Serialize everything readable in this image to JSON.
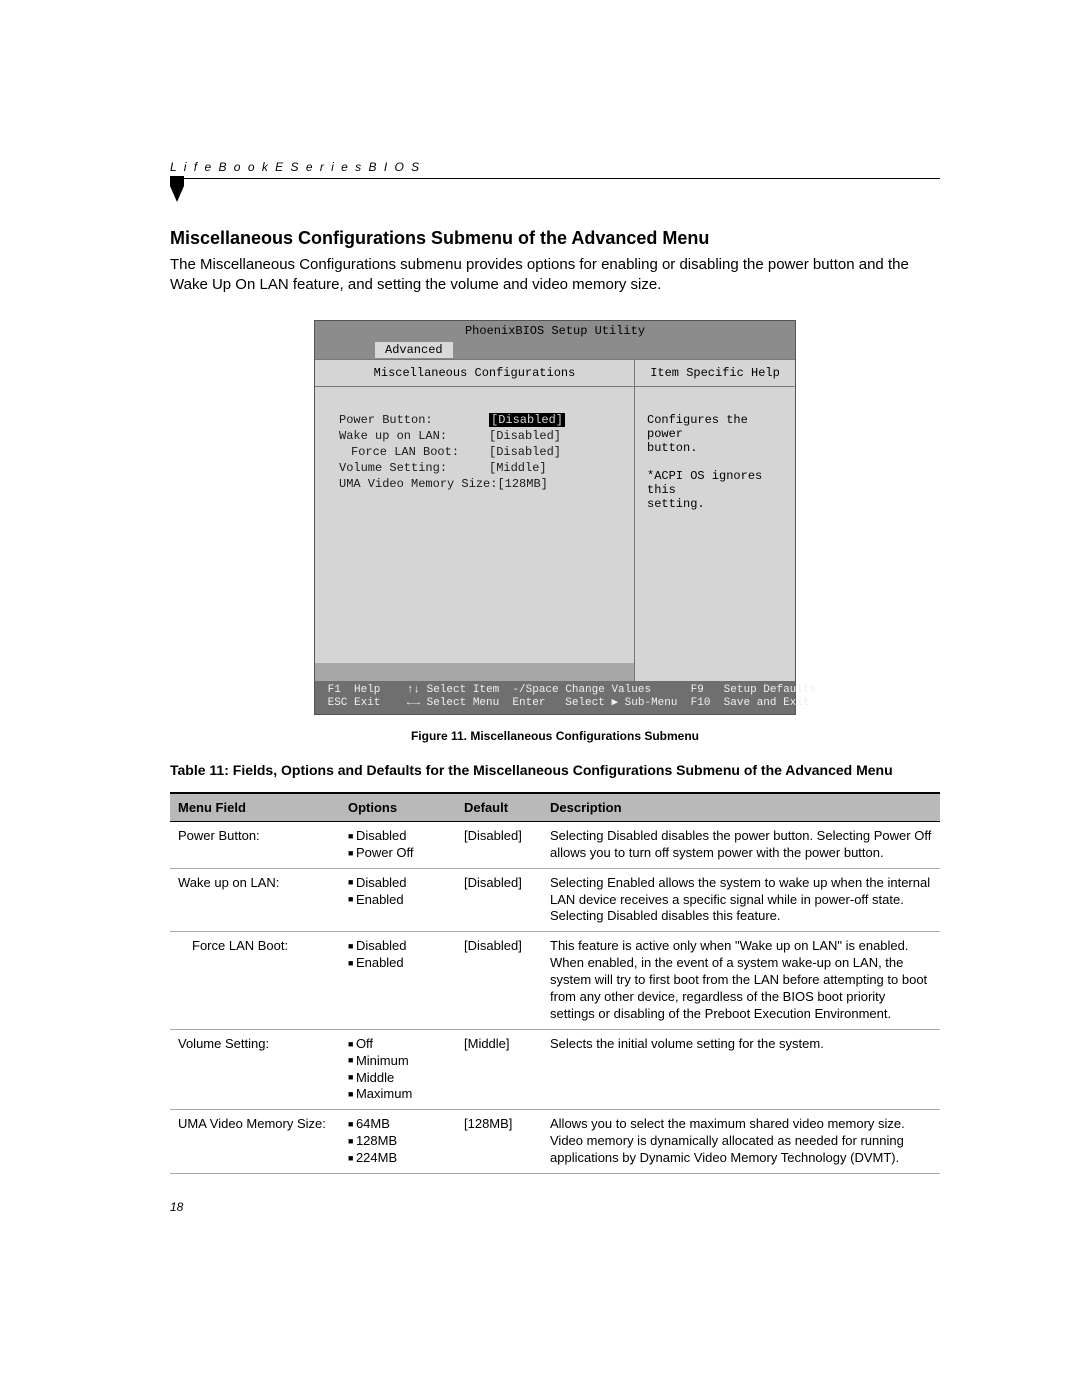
{
  "header": "L i f e B o o k   E   S e r i e s   B I O S",
  "section_title": "Miscellaneous Configurations Submenu of the Advanced Menu",
  "intro": "The Miscellaneous Configurations submenu provides options for enabling or disabling the power button and the Wake Up On LAN feature, and setting the volume and video memory size.",
  "bios": {
    "title": "PhoenixBIOS Setup Utility",
    "tab": "Advanced",
    "left_title": "Miscellaneous Configurations",
    "right_title": "Item Specific Help",
    "settings": [
      {
        "label": "Power Button:",
        "value": "[Disabled]",
        "highlight": true,
        "indent": false
      },
      {
        "label": "Wake up on LAN:",
        "value": "[Disabled]",
        "highlight": false,
        "indent": false
      },
      {
        "label": "Force LAN Boot:",
        "value": "[Disabled]",
        "highlight": false,
        "indent": true
      },
      {
        "label": "Volume Setting:",
        "value": "[Middle]",
        "highlight": false,
        "indent": false
      },
      {
        "label": "UMA Video Memory Size:",
        "value": "[128MB]",
        "highlight": false,
        "indent": false
      }
    ],
    "help_text": "Configures the power\nbutton.\n\n*ACPI OS ignores this\nsetting.",
    "footer_line1_keys": [
      "F1",
      "↑↓",
      "-/Space",
      "F9"
    ],
    "footer_line1_labels": [
      "Help",
      "Select Item",
      "Change Values",
      "Setup Defaults"
    ],
    "footer_line2_keys": [
      "ESC",
      "←→",
      "Enter",
      "F10"
    ],
    "footer_line2_labels": [
      "Exit",
      "Select Menu",
      "Select ▶ Sub-Menu",
      "Save and Exit"
    ]
  },
  "figure_caption": "Figure 11.  Miscellaneous Configurations Submenu",
  "table_caption": "Table 11: Fields, Options and Defaults for the Miscellaneous Configurations Submenu of the Advanced Menu",
  "table": {
    "headers": [
      "Menu Field",
      "Options",
      "Default",
      "Description"
    ],
    "rows": [
      {
        "field": "Power Button:",
        "options": [
          "Disabled",
          "Power Off"
        ],
        "default": "[Disabled]",
        "desc": "Selecting Disabled disables the power button. Selecting Power Off allows you to turn off system power with the power button.",
        "indent": false
      },
      {
        "field": "Wake up on LAN:",
        "options": [
          "Disabled",
          "Enabled"
        ],
        "default": "[Disabled]",
        "desc": "Selecting Enabled allows the system to wake up when the internal LAN device receives a specific signal while in power-off state. Selecting Disabled disables this feature.",
        "indent": false
      },
      {
        "field": "Force LAN Boot:",
        "options": [
          "Disabled",
          "Enabled"
        ],
        "default": "[Disabled]",
        "desc": "This feature is active only when \"Wake up on LAN\" is enabled. When enabled, in the event of a system wake-up on LAN, the system will try to first boot from the LAN before attempting to boot from any other device, regardless of the BIOS boot priority settings or disabling of the Preboot Execution Environment.",
        "indent": true
      },
      {
        "field": "Volume Setting:",
        "options": [
          "Off",
          "Minimum",
          "Middle",
          "Maximum"
        ],
        "default": "[Middle]",
        "desc": "Selects the initial volume setting for the system.",
        "indent": false
      },
      {
        "field": "UMA Video Memory Size:",
        "options": [
          "64MB",
          "128MB",
          "224MB"
        ],
        "default": "[128MB]",
        "desc": "Allows you to select the maximum shared video memory size. Video memory is dynamically allocated as needed for running applications by Dynamic Video Memory Technology (DVMT).",
        "indent": false
      }
    ]
  },
  "page_number": "18"
}
